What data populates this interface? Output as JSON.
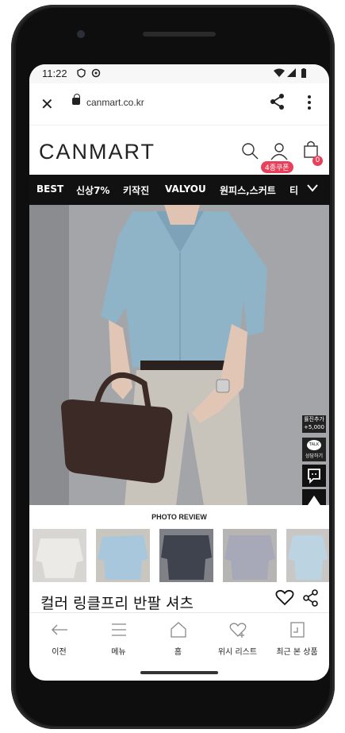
{
  "status": {
    "time": "11:22"
  },
  "browser": {
    "url": "canmart.co.kr"
  },
  "site": {
    "logo": "CANMART",
    "coupon_badge": "4종쿠폰",
    "cart_count": "0",
    "brand_color": "#e8405a"
  },
  "categories": [
    "BEST",
    "신상7%",
    "키작진",
    "VALYOU",
    "원피스,스커트",
    "티"
  ],
  "floating": {
    "photo_add": "률진추가",
    "photo_points": "+5,000",
    "talk_badge": "TALK",
    "talk_label": "상담하기"
  },
  "reviews": {
    "title": "PHOTO REVIEW"
  },
  "product": {
    "title": "컬러 링클프리 반팔 셔츠"
  },
  "bottom_nav": [
    {
      "label": "이전",
      "icon": "back-arrow-icon"
    },
    {
      "label": "메뉴",
      "icon": "hamburger-icon"
    },
    {
      "label": "홈",
      "icon": "home-icon"
    },
    {
      "label": "위시 리스트",
      "icon": "wishlist-heart-icon"
    },
    {
      "label": "최근 본 상품",
      "icon": "recent-items-icon"
    }
  ]
}
